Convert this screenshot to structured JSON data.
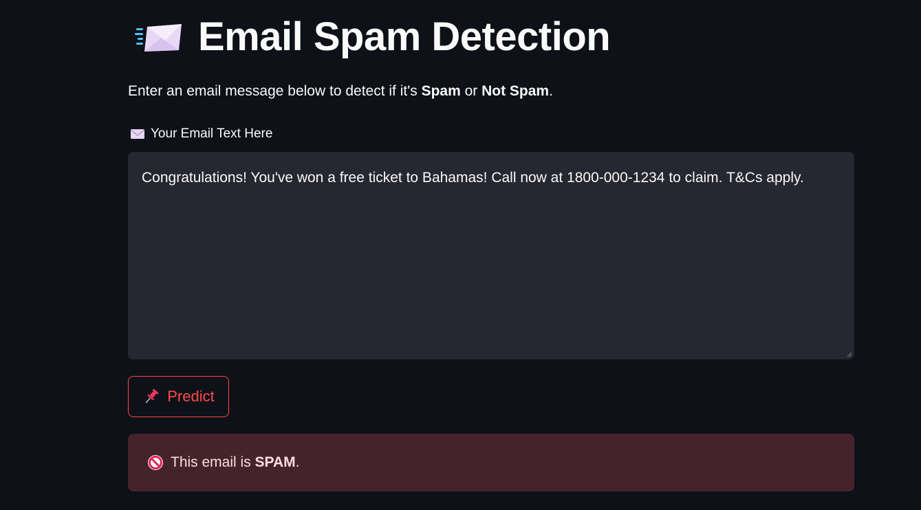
{
  "header": {
    "title": "Email Spam Detection",
    "title_icon": "flying-envelope-icon"
  },
  "intro": {
    "prefix": "Enter an email message below to detect if it's ",
    "spam_word": "Spam",
    "middle": " or ",
    "not_spam_word": "Not Spam",
    "suffix": "."
  },
  "email_field": {
    "label_icon": "envelope-icon",
    "label": "Your Email Text Here",
    "value": "Congratulations! You've won a free ticket to Bahamas! Call now at 1800-000-1234 to claim. T&Cs apply."
  },
  "predict_button": {
    "icon": "pushpin-icon",
    "label": "Predict"
  },
  "result": {
    "icon": "prohibited-icon",
    "prefix": "This email is ",
    "verdict": "SPAM",
    "suffix": "."
  },
  "colors": {
    "background": "#0e1117",
    "input_bg": "#262730",
    "accent": "#ff4b4b",
    "error_bg": "#45232b"
  }
}
